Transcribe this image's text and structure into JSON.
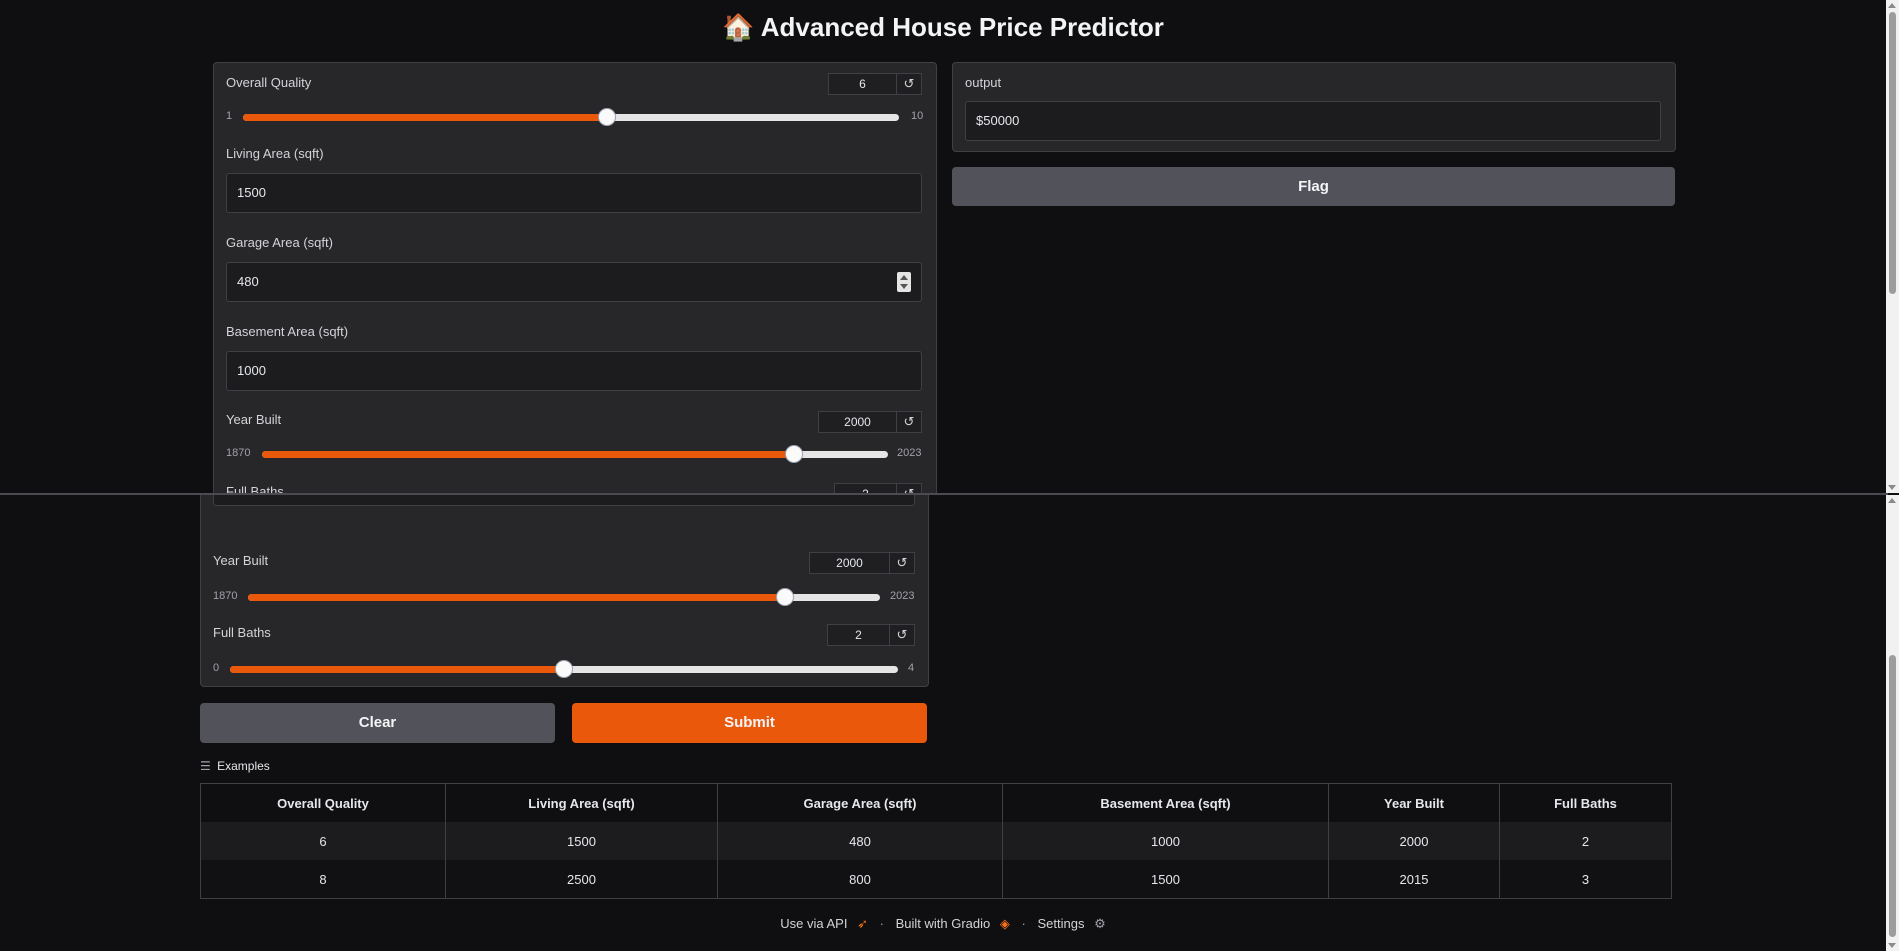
{
  "app": {
    "title_icon": "🏠",
    "title": "Advanced House Price Predictor"
  },
  "colors": {
    "accent": "#ea580c",
    "panel": "#27272a",
    "background": "#0f0f11"
  },
  "inputs": {
    "overall_quality": {
      "label": "Overall Quality",
      "value": "6",
      "min": "1",
      "max": "10",
      "level": 0.5556
    },
    "living_area": {
      "label": "Living Area (sqft)",
      "value": "1500"
    },
    "garage_area": {
      "label": "Garage Area (sqft)",
      "value": "480"
    },
    "basement_area": {
      "label": "Basement Area (sqft)",
      "value": "1000"
    },
    "year_built": {
      "label": "Year Built",
      "value": "2000",
      "min": "1870",
      "max": "2023",
      "level": 0.8497
    },
    "full_baths": {
      "label": "Full Baths",
      "value": "2",
      "min": "0",
      "max": "4",
      "level": 0.5
    }
  },
  "reset_icon": "↺",
  "output": {
    "label": "output",
    "value": "$50000"
  },
  "buttons": {
    "flag": "Flag",
    "clear": "Clear",
    "submit": "Submit"
  },
  "examples": {
    "header": "Examples",
    "icon": "list-icon",
    "columns": [
      "Overall Quality",
      "Living Area (sqft)",
      "Garage Area (sqft)",
      "Basement Area (sqft)",
      "Year Built",
      "Full Baths"
    ],
    "rows": [
      [
        "6",
        "1500",
        "480",
        "1000",
        "2000",
        "2"
      ],
      [
        "8",
        "2500",
        "800",
        "1500",
        "2015",
        "3"
      ]
    ]
  },
  "footer": {
    "api": "Use via API",
    "built": "Built with Gradio",
    "settings": "Settings",
    "separator": "·"
  }
}
